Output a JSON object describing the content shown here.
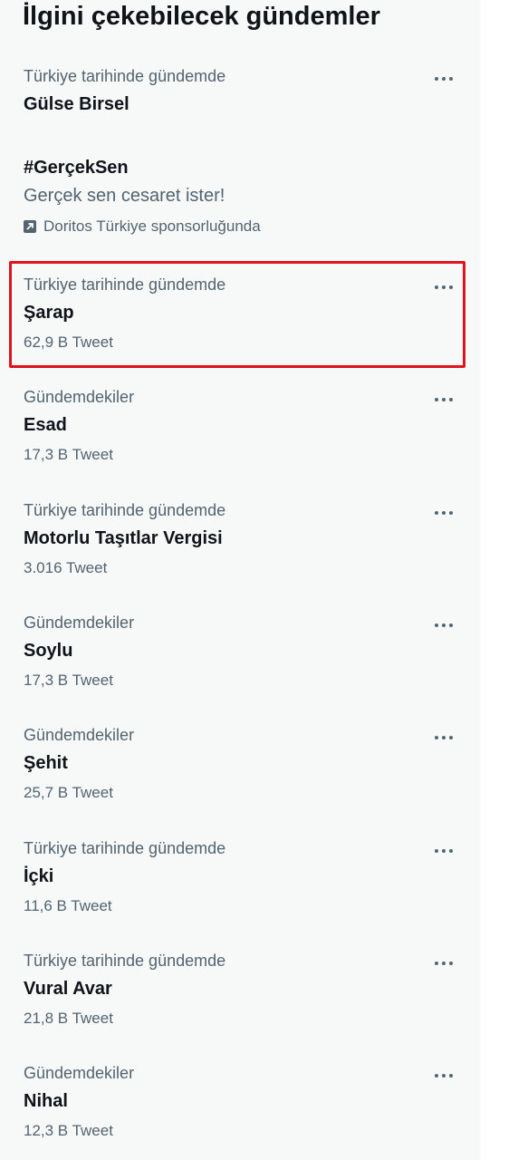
{
  "panel": {
    "title": "İlgini çekebilecek gündemler"
  },
  "trends": [
    {
      "context": "Türkiye tarihinde gündemde",
      "name": "Gülse Birsel"
    },
    {
      "name": "#GerçekSen",
      "description": "Gerçek sen cesaret ister!",
      "promoted_by": "Doritos Türkiye sponsorluğunda",
      "promo_icon": "promoted-arrow-icon"
    },
    {
      "context": "Türkiye tarihinde gündemde",
      "name": "Şarap",
      "count": "62,9 B Tweet"
    },
    {
      "context": "Gündemdekiler",
      "name": "Esad",
      "count": "17,3 B Tweet"
    },
    {
      "context": "Türkiye tarihinde gündemde",
      "name": "Motorlu Taşıtlar Vergisi",
      "count": "3.016 Tweet"
    },
    {
      "context": "Gündemdekiler",
      "name": "Soylu",
      "count": "17,3 B Tweet"
    },
    {
      "context": "Gündemdekiler",
      "name": "Şehit",
      "count": "25,7 B Tweet"
    },
    {
      "context": "Türkiye tarihinde gündemde",
      "name": "İçki",
      "count": "11,6 B Tweet"
    },
    {
      "context": "Türkiye tarihinde gündemde",
      "name": "Vural Avar",
      "count": "21,8 B Tweet"
    },
    {
      "context": "Gündemdekiler",
      "name": "Nihal",
      "count": "12,3 B Tweet"
    }
  ],
  "highlight_color": "#e0131c",
  "more_icon": "more-options-icon"
}
